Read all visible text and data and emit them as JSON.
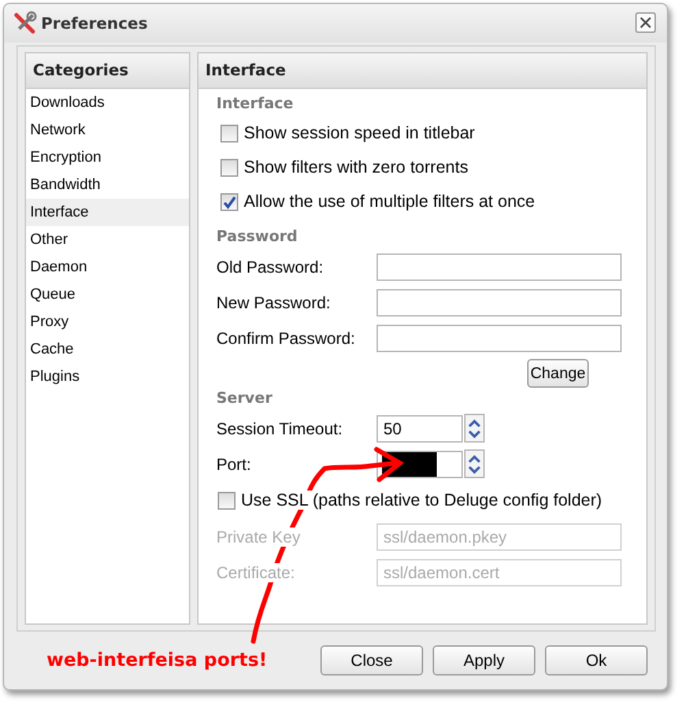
{
  "window": {
    "title": "Preferences"
  },
  "categories": {
    "title": "Categories",
    "items": [
      {
        "label": "Downloads",
        "selected": false
      },
      {
        "label": "Network",
        "selected": false
      },
      {
        "label": "Encryption",
        "selected": false
      },
      {
        "label": "Bandwidth",
        "selected": false
      },
      {
        "label": "Interface",
        "selected": true
      },
      {
        "label": "Other",
        "selected": false
      },
      {
        "label": "Daemon",
        "selected": false
      },
      {
        "label": "Queue",
        "selected": false
      },
      {
        "label": "Proxy",
        "selected": false
      },
      {
        "label": "Cache",
        "selected": false
      },
      {
        "label": "Plugins",
        "selected": false
      }
    ]
  },
  "panel": {
    "title": "Interface",
    "interface_section": {
      "legend": "Interface",
      "options": [
        {
          "label": "Show session speed in titlebar",
          "checked": false
        },
        {
          "label": "Show filters with zero torrents",
          "checked": false
        },
        {
          "label": "Allow the use of multiple filters at once",
          "checked": true
        }
      ]
    },
    "password_section": {
      "legend": "Password",
      "fields": [
        {
          "label": "Old Password:"
        },
        {
          "label": "New Password:"
        },
        {
          "label": "Confirm Password:"
        }
      ],
      "button": "Change"
    },
    "server_section": {
      "legend": "Server",
      "spinners": [
        {
          "label": "Session Timeout:",
          "value": "50",
          "redacted": false
        },
        {
          "label": "Port:",
          "redacted": true
        }
      ],
      "ssl": {
        "label": "Use SSL (paths relative to Deluge config folder)",
        "checked": false
      },
      "fields": [
        {
          "label": "Private Key",
          "value": "ssl/daemon.pkey",
          "disabled": true
        },
        {
          "label": "Certificate:",
          "value": "ssl/daemon.cert",
          "disabled": true
        }
      ]
    }
  },
  "annotation": {
    "text": "web-interfeisa ports!"
  },
  "buttons": [
    {
      "label": "Close"
    },
    {
      "label": "Apply"
    },
    {
      "label": "Ok"
    }
  ]
}
